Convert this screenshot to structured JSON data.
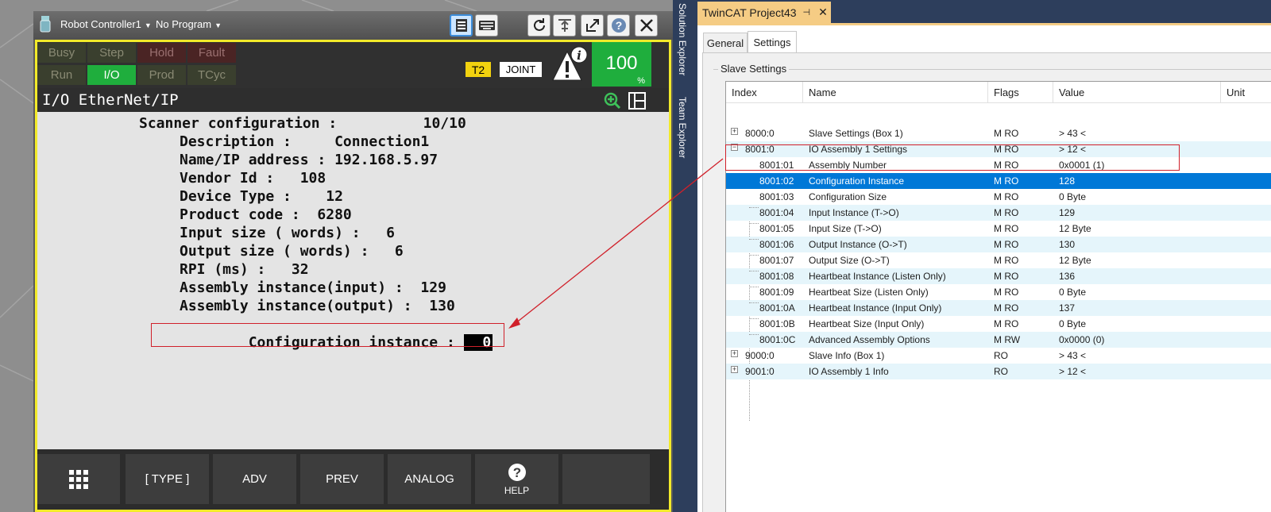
{
  "pendant": {
    "controller_menu": "Robot Controller1",
    "program_menu": "No Program",
    "status": {
      "busy": "Busy",
      "step": "Step",
      "hold": "Hold",
      "fault": "Fault",
      "run": "Run",
      "io": "I/O",
      "prod": "Prod",
      "tcyc": "TCyc"
    },
    "t2": "T2",
    "joint": "JOINT",
    "override_value": "100",
    "override_unit": "%",
    "screen_title": "I/O EtherNet/IP",
    "lines": {
      "scanner": "Scanner configuration :          10/10",
      "description": "Description :     Connection1",
      "name_ip": "Name/IP address : 192.168.5.97",
      "vendor": "Vendor Id :   108",
      "device_type": "Device Type :    12",
      "product_code": "Product code :  6280",
      "input_size": "Input size ( words) :   6",
      "output_size": "Output size ( words) :   6",
      "rpi": "RPI (ms) :   32",
      "asm_input": "Assembly instance(input) :  129",
      "asm_output": "Assembly instance(output) :  130",
      "config_label": "Configuration instance : ",
      "config_value": "  0"
    },
    "fkeys": {
      "type": "[ TYPE ]",
      "adv": "ADV",
      "prev": "PREV",
      "analog": "ANALOG",
      "help": "HELP"
    },
    "icons": [
      "menu-grid-icon",
      "keyboard-icon",
      "refresh-icon",
      "teach-icon",
      "export-icon",
      "help-icon",
      "close-icon",
      "zoom-icon",
      "split-icon",
      "warning-icon"
    ]
  },
  "sidebar": {
    "solution_explorer": "Solution Explorer",
    "team_explorer": "Team Explorer"
  },
  "twincat": {
    "doc_tab": "TwinCAT Project43",
    "pin_glyph": "⊣",
    "close_glyph": "✕",
    "tabs": {
      "general": "General",
      "settings": "Settings"
    },
    "group": "Slave Settings",
    "headers": {
      "index": "Index",
      "name": "Name",
      "flags": "Flags",
      "value": "Value",
      "unit": "Unit"
    },
    "rows": [
      {
        "index": "8000:0",
        "name": "Slave Settings (Box 1)",
        "flags": "M RO",
        "value": "> 43 <"
      },
      {
        "index": "8001:0",
        "name": "IO Assembly 1 Settings",
        "flags": "M RO",
        "value": "> 12 <"
      },
      {
        "index": "8001:01",
        "name": "Assembly Number",
        "flags": "M RO",
        "value": "0x0001 (1)"
      },
      {
        "index": "8001:02",
        "name": "Configuration Instance",
        "flags": "M RO",
        "value": "128"
      },
      {
        "index": "8001:03",
        "name": "Configuration Size",
        "flags": "M RO",
        "value": "0 Byte"
      },
      {
        "index": "8001:04",
        "name": "Input Instance (T->O)",
        "flags": "M RO",
        "value": "129"
      },
      {
        "index": "8001:05",
        "name": "Input Size (T->O)",
        "flags": "M RO",
        "value": "12 Byte"
      },
      {
        "index": "8001:06",
        "name": "Output Instance (O->T)",
        "flags": "M RO",
        "value": "130"
      },
      {
        "index": "8001:07",
        "name": "Output Size (O->T)",
        "flags": "M RO",
        "value": "12 Byte"
      },
      {
        "index": "8001:08",
        "name": "Heartbeat Instance (Listen Only)",
        "flags": "M RO",
        "value": "136"
      },
      {
        "index": "8001:09",
        "name": "Heartbeat Size (Listen Only)",
        "flags": "M RO",
        "value": "0 Byte"
      },
      {
        "index": "8001:0A",
        "name": "Heartbeat Instance (Input Only)",
        "flags": "M RO",
        "value": "137"
      },
      {
        "index": "8001:0B",
        "name": "Heartbeat Size (Input Only)",
        "flags": "M RO",
        "value": "0 Byte"
      },
      {
        "index": "8001:0C",
        "name": "Advanced Assembly Options",
        "flags": "M RW",
        "value": "0x0000 (0)"
      },
      {
        "index": "9000:0",
        "name": "Slave Info (Box 1)",
        "flags": "RO",
        "value": "> 43 <"
      },
      {
        "index": "9001:0",
        "name": "IO Assembly 1 Info",
        "flags": "RO",
        "value": "> 12 <"
      }
    ],
    "expanders": {
      "plus": "+",
      "minus": "−"
    }
  },
  "colors": {
    "yellow_frame": "#f2ea2a",
    "green_status": "#1fae3d",
    "selection_blue": "#0078d7",
    "annotation_red": "#d0202a",
    "vs_tab_gold": "#f5cc84"
  }
}
